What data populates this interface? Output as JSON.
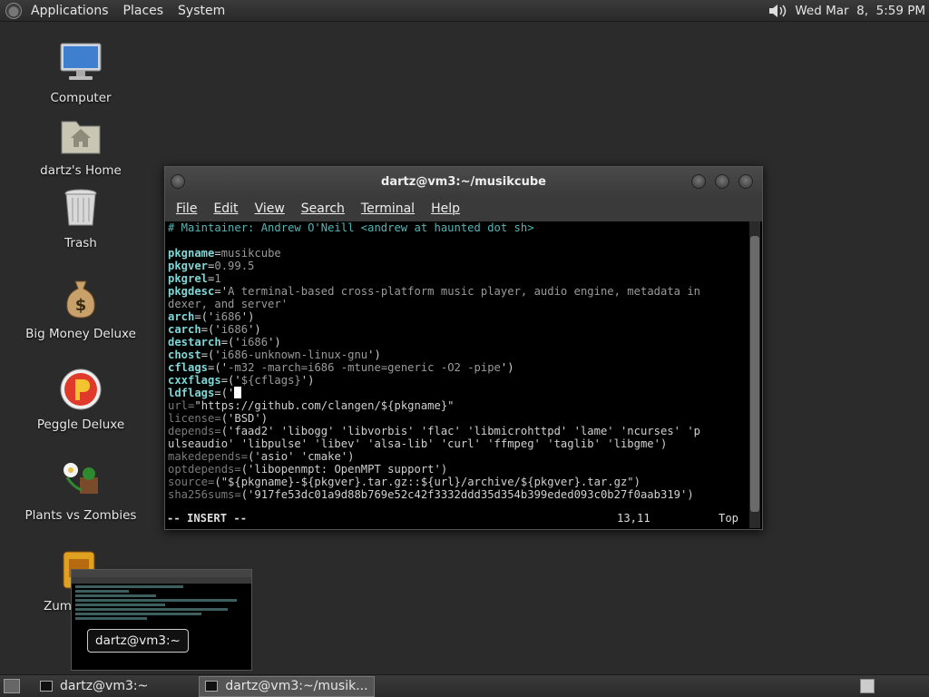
{
  "top_panel": {
    "menus": [
      "Applications",
      "Places",
      "System"
    ],
    "clock": "Wed Mar  8,  5:59 PM"
  },
  "desktop_icons": [
    {
      "label": "Computer",
      "icon": "computer-icon"
    },
    {
      "label": "dartz's Home",
      "icon": "home-folder-icon"
    },
    {
      "label": "Trash",
      "icon": "trash-icon"
    },
    {
      "label": "Big Money Deluxe",
      "icon": "money-bag-icon"
    },
    {
      "label": "Peggle Deluxe",
      "icon": "peggle-icon"
    },
    {
      "label": "Plants vs Zombies",
      "icon": "plants-vs-zombies-icon"
    },
    {
      "label": "Zum",
      "icon": "zuma-icon"
    }
  ],
  "terminal": {
    "title": "dartz@vm3:~/musikcube",
    "menus": [
      "File",
      "Edit",
      "View",
      "Search",
      "Terminal",
      "Help"
    ],
    "lines": [
      "# Maintainer: Andrew O'Neill <andrew at haunted dot sh>",
      "",
      "pkgname=musikcube",
      "pkgver=0.99.5",
      "pkgrel=1",
      "pkgdesc='A terminal-based cross-platform music player, audio engine, metadata in",
      "dexer, and server'",
      "arch=('i686')",
      "carch=('i686')",
      "destarch=('i686')",
      "chost=('i686-unknown-linux-gnu')",
      "cflags=('-m32 -march=i686 -mtune=generic -O2 -pipe')",
      "cxxflags=('${cflags}')",
      "ldflags=('",
      "url=\"https://github.com/clangen/${pkgname}\"",
      "license=('BSD')",
      "depends=('faad2' 'libogg' 'libvorbis' 'flac' 'libmicrohttpd' 'lame' 'ncurses' 'p",
      "ulseaudio' 'libpulse' 'libev' 'alsa-lib' 'curl' 'ffmpeg' 'taglib' 'libgme')",
      "makedepends=('asio' 'cmake')",
      "optdepends=('libopenmpt: OpenMPT support')",
      "source=(\"${pkgname}-${pkgver}.tar.gz::${url}/archive/${pkgver}.tar.gz\")",
      "sha256sums=('917fe53dc01a9d88b769e52c42f3332ddd35d354b399eded093c0b27f0aab319')"
    ],
    "status_mode": "-- INSERT --",
    "status_pos": "13,11",
    "status_scroll": "Top"
  },
  "preview": {
    "tooltip": "dartz@vm3:~"
  },
  "bottom_panel": {
    "tasks": [
      "dartz@vm3:~",
      "dartz@vm3:~/musik..."
    ]
  }
}
